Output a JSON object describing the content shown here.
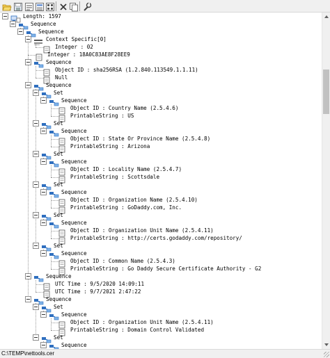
{
  "toolbar": {
    "buttons": [
      {
        "name": "open-file",
        "icon": "folder-open-icon"
      },
      {
        "name": "save",
        "icon": "save-icon"
      },
      {
        "name": "view-hex",
        "icon": "hex-view-icon"
      },
      {
        "name": "view-text",
        "icon": "text-view-icon"
      },
      {
        "name": "view-binary",
        "icon": "binary-view-icon"
      },
      {
        "name": "close",
        "icon": "close-icon"
      },
      {
        "name": "copy",
        "icon": "copy-icon"
      },
      {
        "name": "settings",
        "icon": "wrench-icon"
      }
    ]
  },
  "tree": {
    "nodes": [
      {
        "label": "Length: 1597",
        "level": 0,
        "type": "root",
        "expanded": true
      },
      {
        "label": "Sequence",
        "level": 1,
        "type": "container",
        "expanded": true
      },
      {
        "label": "Sequence",
        "level": 2,
        "type": "container",
        "expanded": true
      },
      {
        "label": "Context Specific[0]",
        "level": 3,
        "type": "context",
        "expanded": true
      },
      {
        "label": "Integer : 02",
        "level": 4,
        "type": "leaf"
      },
      {
        "label": "Integer : 18A0C83AE8F28EE9",
        "level": 3,
        "type": "leaf"
      },
      {
        "label": "Sequence",
        "level": 3,
        "type": "container",
        "expanded": true
      },
      {
        "label": "Object ID : sha256RSA (1.2.840.113549.1.1.11)",
        "level": 4,
        "type": "leaf"
      },
      {
        "label": "Null",
        "level": 4,
        "type": "leaf"
      },
      {
        "label": "Sequence",
        "level": 3,
        "type": "container",
        "expanded": true
      },
      {
        "label": "Set",
        "level": 4,
        "type": "container",
        "expanded": true
      },
      {
        "label": "Sequence",
        "level": 5,
        "type": "container",
        "expanded": true
      },
      {
        "label": "Object ID : Country Name (2.5.4.6)",
        "level": 6,
        "type": "leaf"
      },
      {
        "label": "PrintableString : US",
        "level": 6,
        "type": "leaf"
      },
      {
        "label": "Set",
        "level": 4,
        "type": "container",
        "expanded": true
      },
      {
        "label": "Sequence",
        "level": 5,
        "type": "container",
        "expanded": true
      },
      {
        "label": "Object ID : State Or Province Name (2.5.4.8)",
        "level": 6,
        "type": "leaf"
      },
      {
        "label": "PrintableString : Arizona",
        "level": 6,
        "type": "leaf"
      },
      {
        "label": "Set",
        "level": 4,
        "type": "container",
        "expanded": true
      },
      {
        "label": "Sequence",
        "level": 5,
        "type": "container",
        "expanded": true
      },
      {
        "label": "Object ID : Locality Name (2.5.4.7)",
        "level": 6,
        "type": "leaf"
      },
      {
        "label": "PrintableString : Scottsdale",
        "level": 6,
        "type": "leaf"
      },
      {
        "label": "Set",
        "level": 4,
        "type": "container",
        "expanded": true
      },
      {
        "label": "Sequence",
        "level": 5,
        "type": "container",
        "expanded": true
      },
      {
        "label": "Object ID : Organization Name (2.5.4.10)",
        "level": 6,
        "type": "leaf"
      },
      {
        "label": "PrintableString : GoDaddy.com, Inc.",
        "level": 6,
        "type": "leaf"
      },
      {
        "label": "Set",
        "level": 4,
        "type": "container",
        "expanded": true
      },
      {
        "label": "Sequence",
        "level": 5,
        "type": "container",
        "expanded": true
      },
      {
        "label": "Object ID : Organization Unit Name (2.5.4.11)",
        "level": 6,
        "type": "leaf"
      },
      {
        "label": "PrintableString : http://certs.godaddy.com/repository/",
        "level": 6,
        "type": "leaf"
      },
      {
        "label": "Set",
        "level": 4,
        "type": "container",
        "expanded": true
      },
      {
        "label": "Sequence",
        "level": 5,
        "type": "container",
        "expanded": true
      },
      {
        "label": "Object ID : Common Name (2.5.4.3)",
        "level": 6,
        "type": "leaf"
      },
      {
        "label": "PrintableString : Go Daddy Secure Certificate Authority - G2",
        "level": 6,
        "type": "leaf"
      },
      {
        "label": "Sequence",
        "level": 3,
        "type": "container",
        "expanded": true
      },
      {
        "label": "UTC Time : 9/5/2020 14:09:11",
        "level": 4,
        "type": "leaf"
      },
      {
        "label": "UTC Time : 9/7/2021 2:47:22",
        "level": 4,
        "type": "leaf"
      },
      {
        "label": "Sequence",
        "level": 3,
        "type": "container",
        "expanded": true
      },
      {
        "label": "Set",
        "level": 4,
        "type": "container",
        "expanded": true
      },
      {
        "label": "Sequence",
        "level": 5,
        "type": "container",
        "expanded": true
      },
      {
        "label": "Object ID : Organization Unit Name (2.5.4.11)",
        "level": 6,
        "type": "leaf"
      },
      {
        "label": "PrintableString : Domain Control Validated",
        "level": 6,
        "type": "leaf"
      },
      {
        "label": "Set",
        "level": 4,
        "type": "container",
        "expanded": true
      },
      {
        "label": "Sequence",
        "level": 5,
        "type": "container",
        "expanded": true
      }
    ]
  },
  "statusbar": {
    "path": "C:\\TEMP\\nettools.cer"
  },
  "colors": {
    "window_bg": "#ffffff",
    "chrome_bg": "#f0f0f0",
    "tree_line": "#9a9a9a",
    "scroll_thumb": "#c1c1c1",
    "node_icon_blue": "#2f6fbf",
    "leaf_icon_fill": "#ffffff"
  }
}
